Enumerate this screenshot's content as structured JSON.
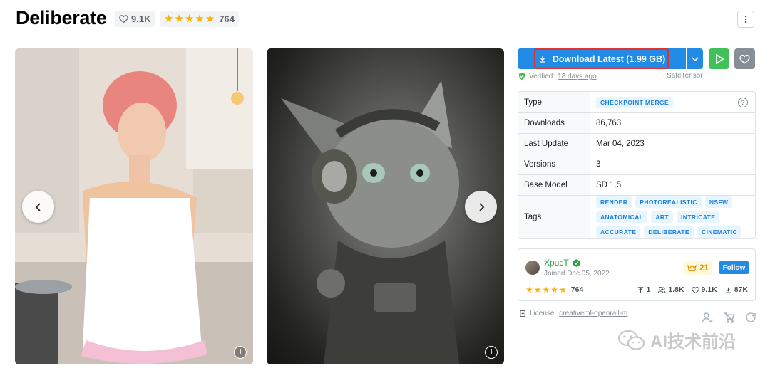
{
  "header": {
    "title": "Deliberate",
    "likes": "9.1K",
    "rating_count": "764"
  },
  "carousel": {
    "prev_label": "‹",
    "next_label": "›"
  },
  "download": {
    "label": "Download Latest (1.99 GB)",
    "verified_prefix": "Verified:",
    "verified_when": "18 days ago",
    "format": "SafeTensor"
  },
  "details": {
    "type_key": "Type",
    "type_value": "CHECKPOINT MERGE",
    "downloads_key": "Downloads",
    "downloads_value": "86,763",
    "last_update_key": "Last Update",
    "last_update_value": "Mar 04, 2023",
    "versions_key": "Versions",
    "versions_value": "3",
    "base_model_key": "Base Model",
    "base_model_value": "SD 1.5",
    "tags_key": "Tags",
    "tags": [
      "RENDER",
      "PHOTOREALISTIC",
      "NSFW",
      "ANATOMICAL",
      "ART",
      "INTRICATE",
      "ACCURATE",
      "DELIBERATE",
      "CINEMATIC"
    ]
  },
  "creator": {
    "name": "XpucT",
    "joined": "Joined Dec 05, 2022",
    "crown_count": "21",
    "follow_label": "Follow",
    "rating_count": "764",
    "uploads": "1",
    "followers": "1.8K",
    "likes": "9.1K",
    "downloads": "87K"
  },
  "license": {
    "prefix": "License:",
    "name": "creativeml-openrail-m"
  },
  "watermark": {
    "text": "AI技术前沿"
  },
  "colors": {
    "primary": "#228be6",
    "success": "#40c057",
    "star": "#fab005",
    "highlight": "#e03131"
  }
}
